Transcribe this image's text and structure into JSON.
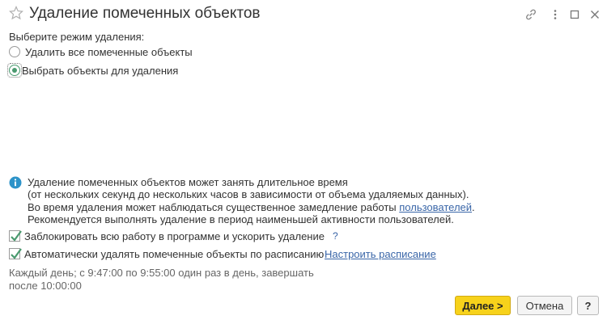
{
  "window": {
    "title": "Удаление помеченных объектов",
    "controls": [
      "link-icon",
      "more-icon",
      "maximize-icon",
      "close-icon"
    ]
  },
  "mode": {
    "label": "Выберите режим удаления:",
    "options": [
      {
        "label": "Удалить все помеченные объекты",
        "selected": false
      },
      {
        "label": "Выбрать объекты для удаления",
        "selected": true
      }
    ]
  },
  "info": {
    "icon": "info-icon",
    "line1": "Удаление помеченных объектов может занять длительное время",
    "line2": "(от нескольких секунд до нескольких часов в зависимости от объема удаляемых данных).",
    "line3_prefix": "Во время удаления может наблюдаться существенное замедление работы ",
    "line3_link": "пользователей",
    "line3_suffix": ".",
    "line4": "Рекомендуется выполнять удаление в период наименьшей активности пользователей."
  },
  "options": {
    "lock_label": "Заблокировать всю работу в программе и ускорить удаление",
    "lock_checked": true,
    "help_mark": "?",
    "schedule_label": "Автоматически удалять помеченные объекты по расписанию",
    "schedule_checked": true,
    "schedule_link": "Настроить расписание",
    "schedule_line1": "Каждый день; с 9:47:00 по 9:55:00 один раз в день, завершать",
    "schedule_line2": "после 10:00:00"
  },
  "buttons": {
    "next": "Далее >",
    "cancel": "Отмена",
    "help": "?"
  },
  "colors": {
    "primary_button": "#f7d21b",
    "link": "#3a66a8",
    "check": "#4a9a6f",
    "info_icon": "#2d93c9"
  }
}
